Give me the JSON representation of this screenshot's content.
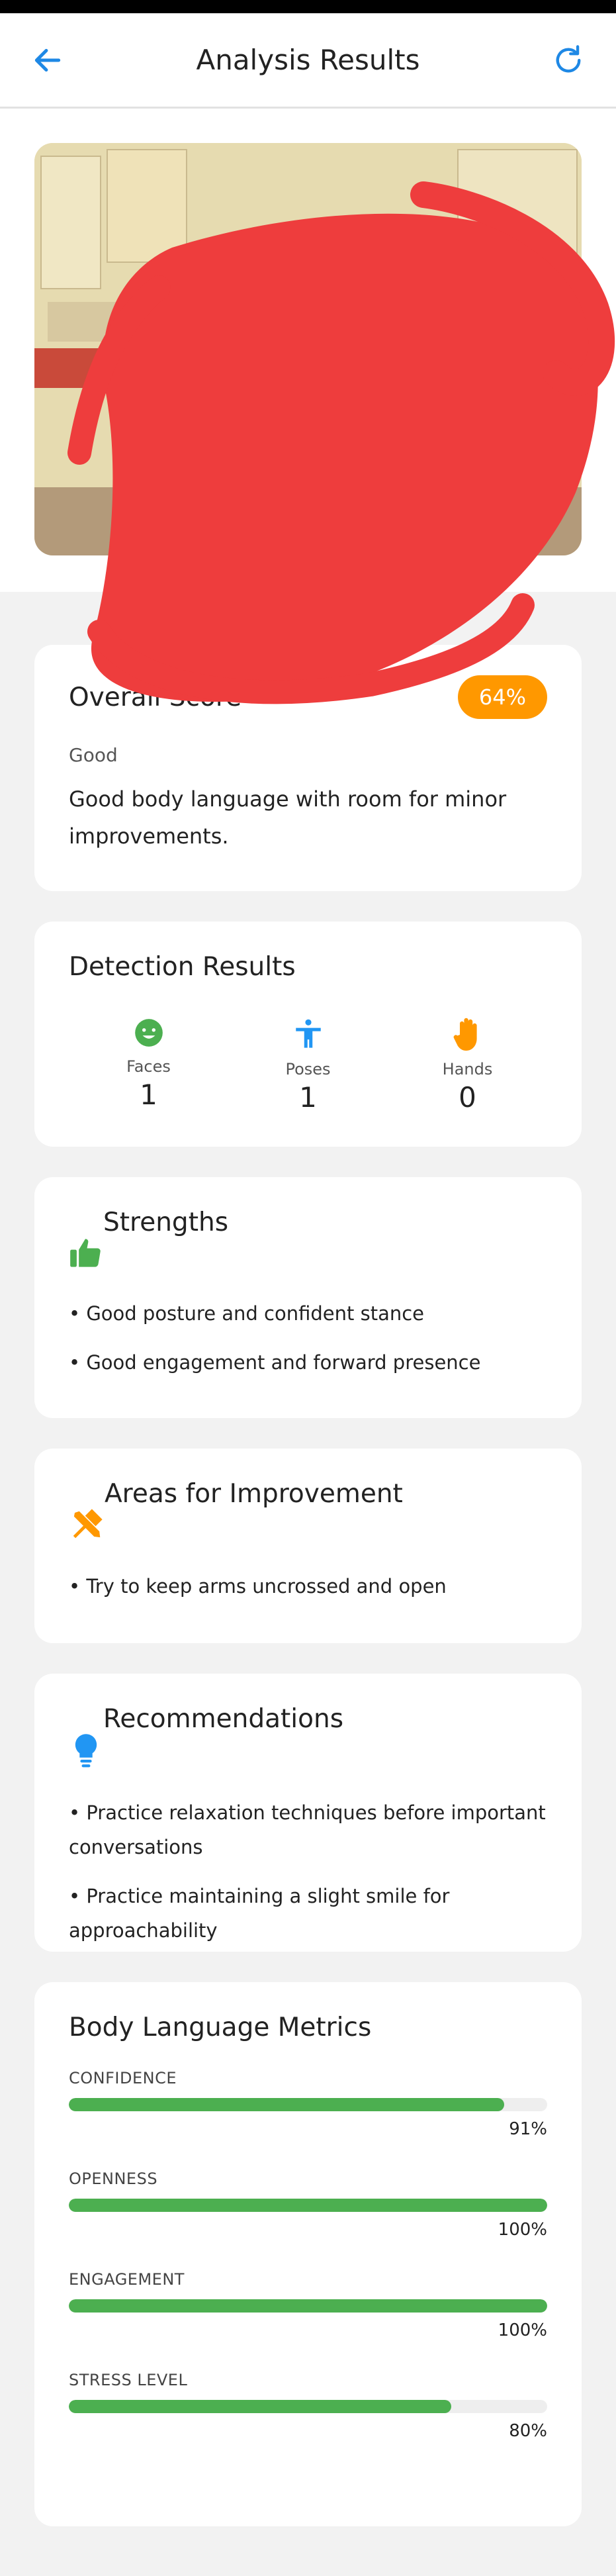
{
  "header": {
    "title": "Analysis Results",
    "back_icon": "arrow-left-icon",
    "refresh_icon": "refresh-icon"
  },
  "overall": {
    "title": "Overall Score",
    "score_label": "64%",
    "rating": "Good",
    "description": "Good body language with room for minor improvements.",
    "badge_color": "#ff9800"
  },
  "detection": {
    "title": "Detection Results",
    "items": [
      {
        "label": "Faces",
        "value": "1",
        "icon": "face-icon",
        "color": "#4caf50"
      },
      {
        "label": "Poses",
        "value": "1",
        "icon": "person-icon",
        "color": "#2196f3"
      },
      {
        "label": "Hands",
        "value": "0",
        "icon": "hand-icon",
        "color": "#ff9800"
      }
    ]
  },
  "strengths": {
    "title": "Strengths",
    "icon": "thumbs-up-icon",
    "items": [
      "• Good posture and confident stance",
      "• Good engagement and forward presence"
    ]
  },
  "improvement": {
    "title": "Areas for Improvement",
    "icon": "tools-icon",
    "items": [
      "• Try to keep arms uncrossed and open"
    ]
  },
  "recommendations": {
    "title": "Recommendations",
    "icon": "lightbulb-icon",
    "items": [
      "• Practice relaxation techniques before important conversations",
      "• Practice maintaining a slight smile for approachability"
    ]
  },
  "metrics": {
    "title": "Body Language Metrics",
    "bar_color": "#4caf50",
    "items": [
      {
        "label": "Confidence",
        "value_label": "91%",
        "value": 0.91
      },
      {
        "label": "Openness",
        "value_label": "100%",
        "value": 1.0
      },
      {
        "label": "Engagement",
        "value_label": "100%",
        "value": 1.0
      },
      {
        "label": "Stress Level",
        "value_label": "80%",
        "value": 0.8
      }
    ]
  }
}
